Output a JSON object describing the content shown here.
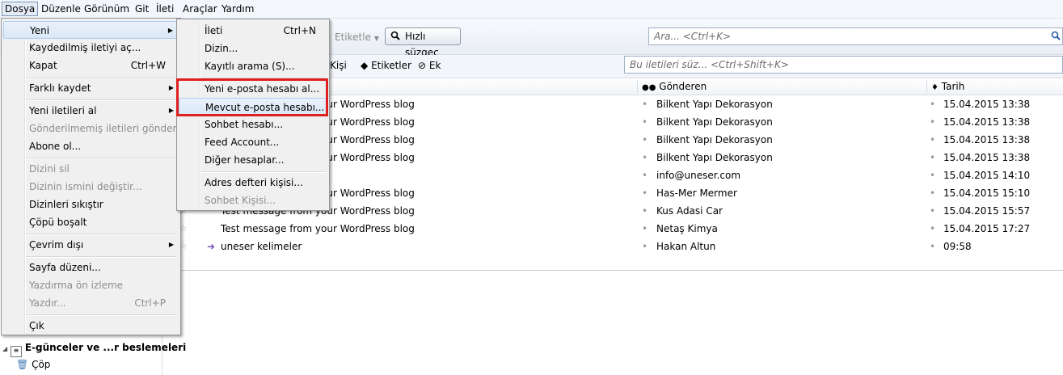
{
  "menubar": [
    "Dosya",
    "Düzenle",
    "Görünüm",
    "Git",
    "İleti",
    "Araçlar",
    "Yardım"
  ],
  "toolbar": {
    "tag_label": "Etiketle",
    "quick_filter": "Hızlı süzgeç",
    "search_placeholder": "Ara... <Ctrl+K>",
    "filter_placeholder": "Bu iletileri süz... <Ctrl+Shift+K>",
    "kisi": "Kişi",
    "etiketler": "Etiketler",
    "ek": "Ek"
  },
  "columns": {
    "from": "Gönderen",
    "date": "Tarih"
  },
  "messages": [
    {
      "subject": "Test message from your WordPress blog",
      "from": "Bilkent Yapı Dekorasyon",
      "date": "15.04.2015 13:38"
    },
    {
      "subject": "Test message from your WordPress blog",
      "from": "Bilkent Yapı Dekorasyon",
      "date": "15.04.2015 13:38"
    },
    {
      "subject": "Test message from your WordPress blog",
      "from": "Bilkent Yapı Dekorasyon",
      "date": "15.04.2015 13:38"
    },
    {
      "subject": "Test message from your WordPress blog",
      "from": "Bilkent Yapı Dekorasyon",
      "date": "15.04.2015 13:38"
    },
    {
      "subject": "",
      "from": "info@uneser.com",
      "date": "15.04.2015 14:10"
    },
    {
      "subject": "Test message from your WordPress blog",
      "from": "Has-Mer Mermer",
      "date": "15.04.2015 15:10"
    },
    {
      "subject": "Test message from your WordPress blog",
      "from": "Kus Adasi Car",
      "date": "15.04.2015 15:57"
    },
    {
      "subject": "Test message from your WordPress blog",
      "from": "Netaş Kimya",
      "date": "15.04.2015 17:27"
    },
    {
      "subject": "uneser kelimeler",
      "from": "Hakan Altun",
      "date": "09:58"
    }
  ],
  "folders": {
    "feeds": "E-günceler ve ...r beslemeleri",
    "trash": "Çöp"
  },
  "file_menu": [
    {
      "label": "Yeni",
      "arrow": true
    },
    {
      "label": "Kaydedilmiş iletiyi aç..."
    },
    {
      "label": "Kapat",
      "shortcut": "Ctrl+W"
    },
    {
      "label": "Farklı kaydet",
      "arrow": true
    },
    {
      "label": "Yeni iletileri al",
      "arrow": true
    },
    {
      "label": "Gönderilmemiş iletileri gönder",
      "disabled": true
    },
    {
      "label": "Abone ol..."
    },
    {
      "label": "Dizini sil",
      "disabled": true
    },
    {
      "label": "Dizinin ismini değiştir...",
      "disabled": true
    },
    {
      "label": "Dizinleri sıkıştır"
    },
    {
      "label": "Çöpü boşalt"
    },
    {
      "label": "Çevrim dışı",
      "arrow": true
    },
    {
      "label": "Sayfa düzeni..."
    },
    {
      "label": "Yazdırma ön izleme",
      "disabled": true
    },
    {
      "label": "Yazdır...",
      "shortcut": "Ctrl+P",
      "disabled": true
    },
    {
      "label": "Çık"
    }
  ],
  "new_menu": [
    {
      "label": "İleti",
      "shortcut": "Ctrl+N"
    },
    {
      "label": "Dizin..."
    },
    {
      "label": "Kayıtlı arama (S)..."
    },
    {
      "label": "Yeni e-posta hesabı al..."
    },
    {
      "label": "Mevcut e-posta hesabı..."
    },
    {
      "label": "Sohbet hesabı..."
    },
    {
      "label": "Feed Account..."
    },
    {
      "label": "Diğer hesaplar..."
    },
    {
      "label": "Adres defteri kişisi..."
    },
    {
      "label": "Sohbet Kişisi...",
      "disabled": true
    }
  ]
}
